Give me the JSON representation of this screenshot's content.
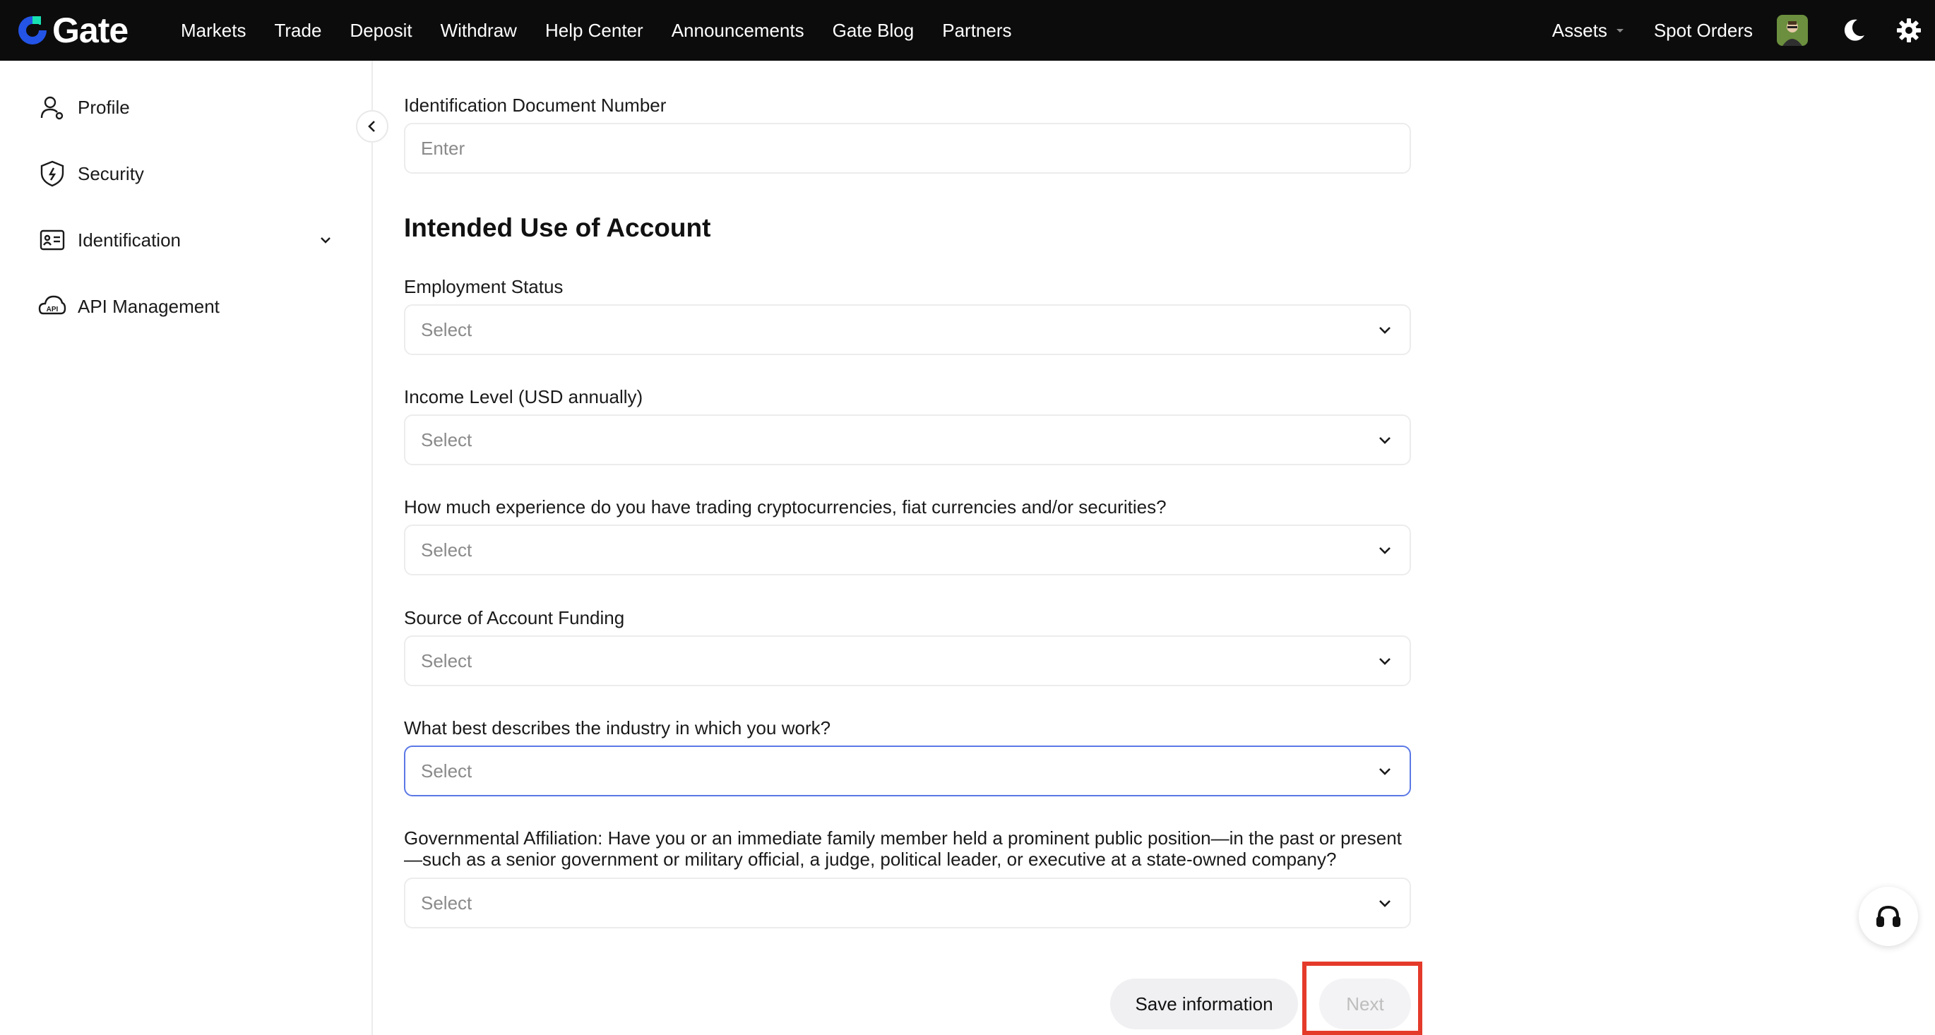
{
  "brand": {
    "name": "Gate",
    "accent": "#2354e6",
    "accent2": "#17e1b2"
  },
  "nav": {
    "items": [
      {
        "label": "Markets"
      },
      {
        "label": "Trade"
      },
      {
        "label": "Deposit"
      },
      {
        "label": "Withdraw"
      },
      {
        "label": "Help Center"
      },
      {
        "label": "Announcements"
      },
      {
        "label": "Gate Blog"
      },
      {
        "label": "Partners"
      }
    ],
    "assets_label": "Assets",
    "spot_orders_label": "Spot Orders",
    "icons": {
      "avatar": "avatar",
      "theme": "moon-icon",
      "settings": "gear-icon"
    }
  },
  "sidebar": {
    "items": [
      {
        "label": "Profile",
        "icon": "user-icon"
      },
      {
        "label": "Security",
        "icon": "shield-icon"
      },
      {
        "label": "Identification",
        "icon": "id-card-icon"
      },
      {
        "label": "API Management",
        "icon": "api-icon"
      }
    ]
  },
  "form": {
    "id_doc_number": {
      "label": "Identification Document Number",
      "placeholder": "Enter"
    },
    "section_title": "Intended Use of Account",
    "employment_status": {
      "label": "Employment Status",
      "value": "Select"
    },
    "income_level": {
      "label": "Income Level (USD annually)",
      "value": "Select"
    },
    "experience": {
      "label": "How much experience do you have trading cryptocurrencies, fiat currencies and/or securities?",
      "value": "Select"
    },
    "funding_source": {
      "label": "Source of Account Funding",
      "value": "Select"
    },
    "industry": {
      "label": "What best describes the industry in which you work?",
      "value": "Select"
    },
    "gov_affiliation": {
      "label_line1": "Governmental Affiliation: Have you or an immediate family member held a prominent public position—in the past or present",
      "label_line2": "—such as a senior government or military official, a judge, political leader, or executive at a state-owned company?",
      "value": "Select"
    },
    "save_label": "Save information",
    "next_label": "Next"
  }
}
